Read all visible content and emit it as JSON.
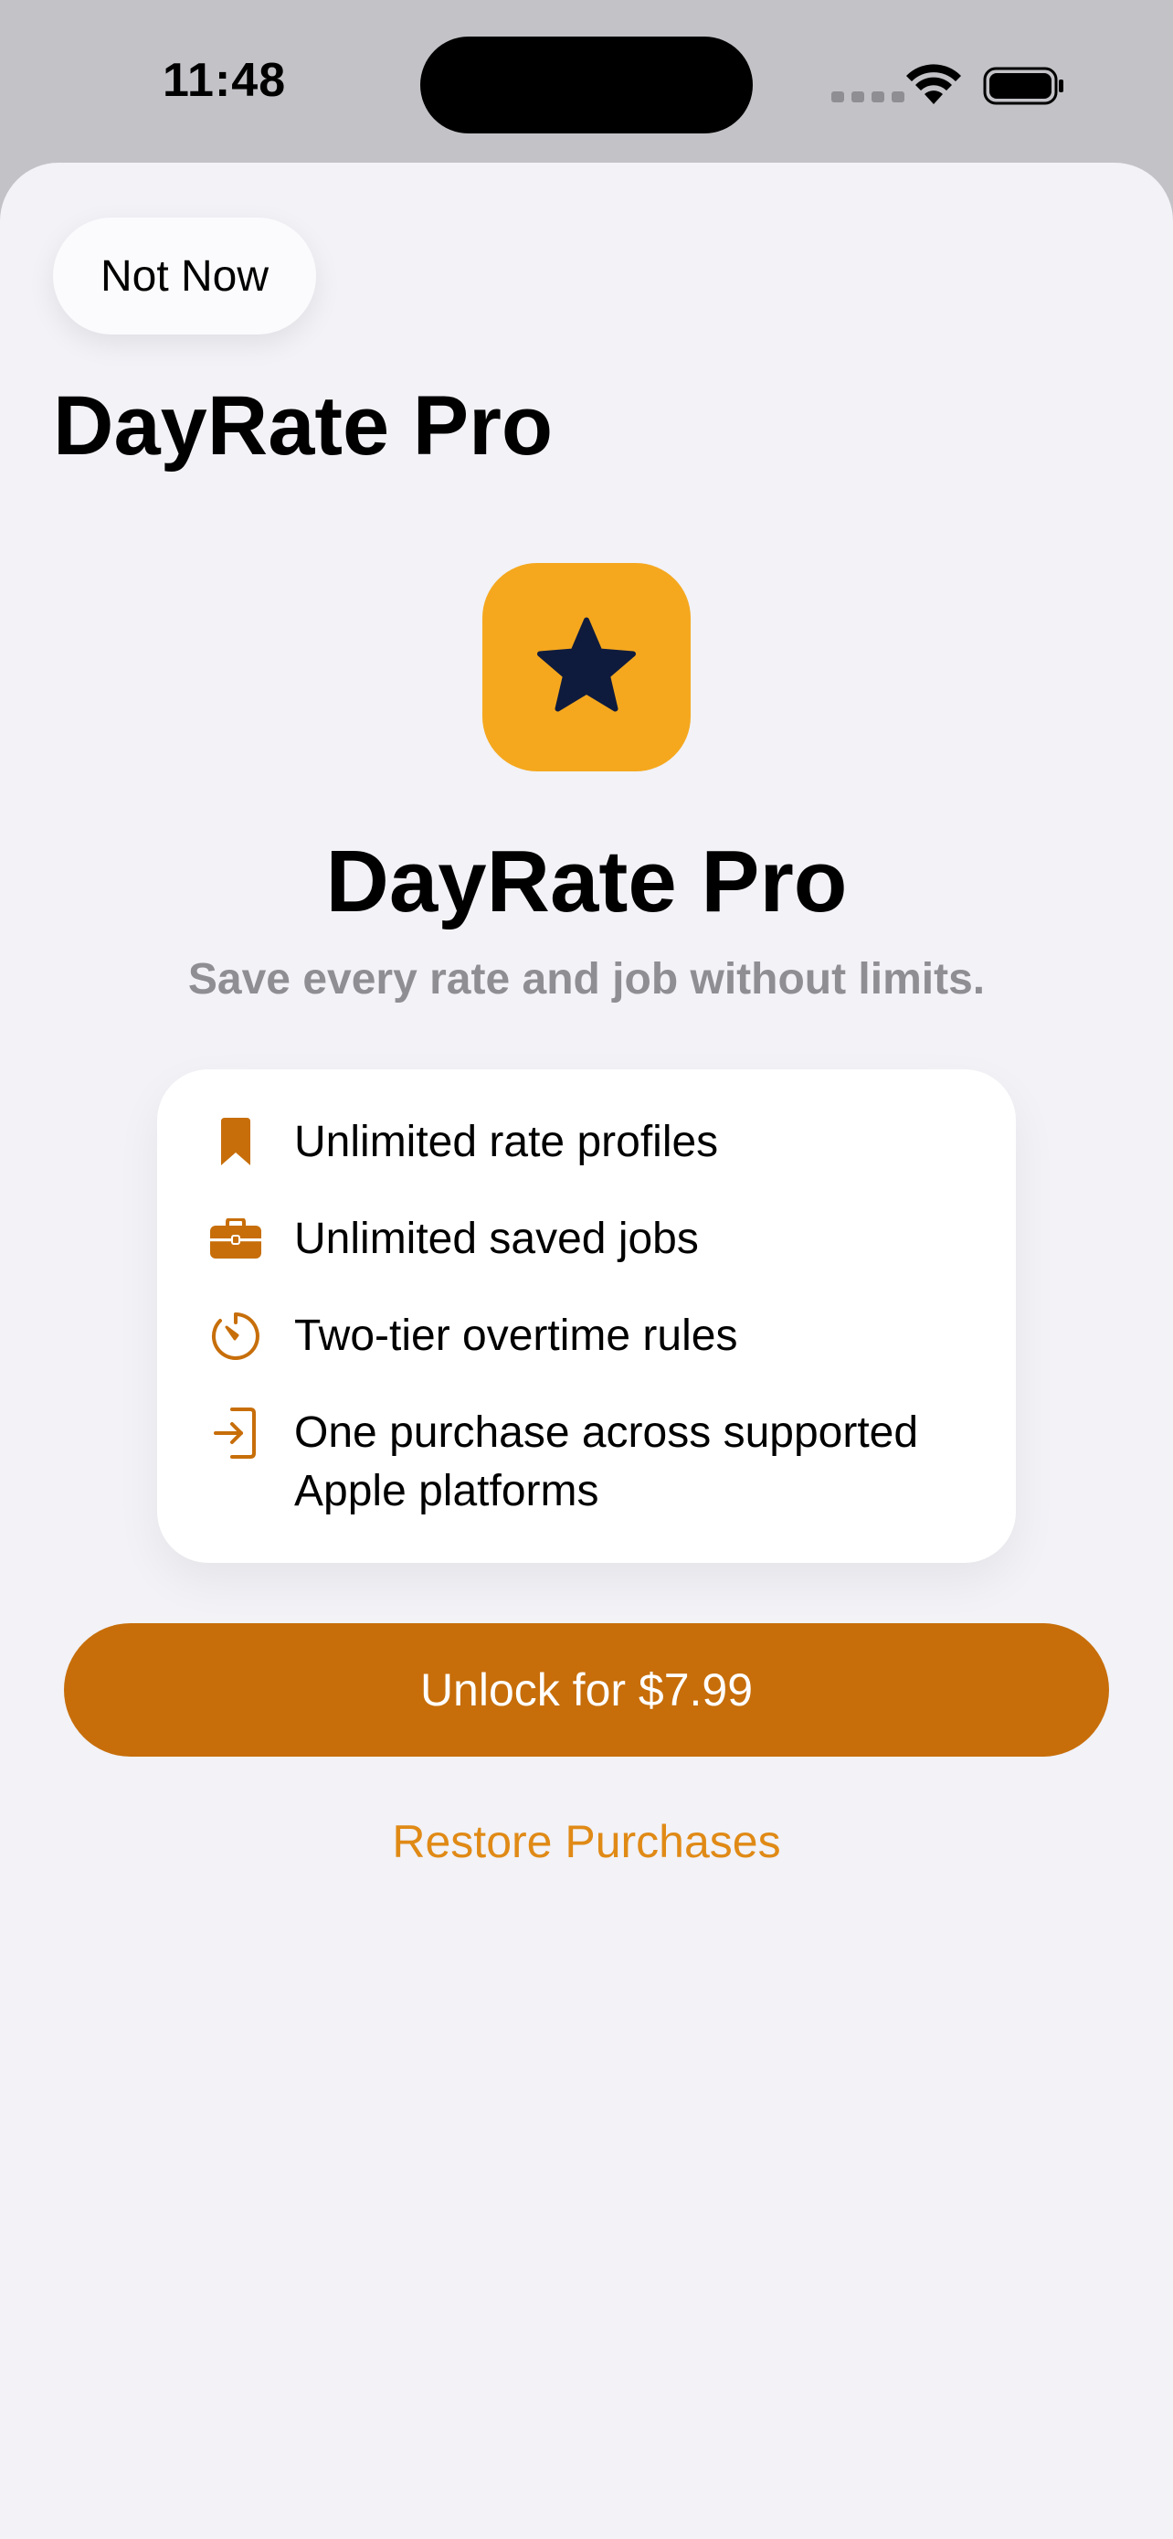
{
  "status_bar": {
    "time": "11:48"
  },
  "sheet": {
    "dismiss_label": "Not Now",
    "nav_title": "DayRate Pro"
  },
  "hero": {
    "icon": "star-icon",
    "title": "DayRate Pro",
    "subtitle": "Save every rate and job without limits."
  },
  "features": [
    {
      "icon": "bookmark-icon",
      "label": "Unlimited rate profiles"
    },
    {
      "icon": "briefcase-icon",
      "label": "Unlimited saved jobs"
    },
    {
      "icon": "timer-icon",
      "label": "Two-tier overtime rules"
    },
    {
      "icon": "sign-in-icon",
      "label": "One purchase across supported Apple platforms"
    }
  ],
  "actions": {
    "unlock_label": "Unlock for $7.99",
    "restore_label": "Restore Purchases"
  },
  "colors": {
    "accent": "#c76e0a",
    "accent_light": "#e08a16",
    "icon_background": "#f5a81e",
    "star": "#0f1b3d",
    "background": "#f2f2f7"
  }
}
